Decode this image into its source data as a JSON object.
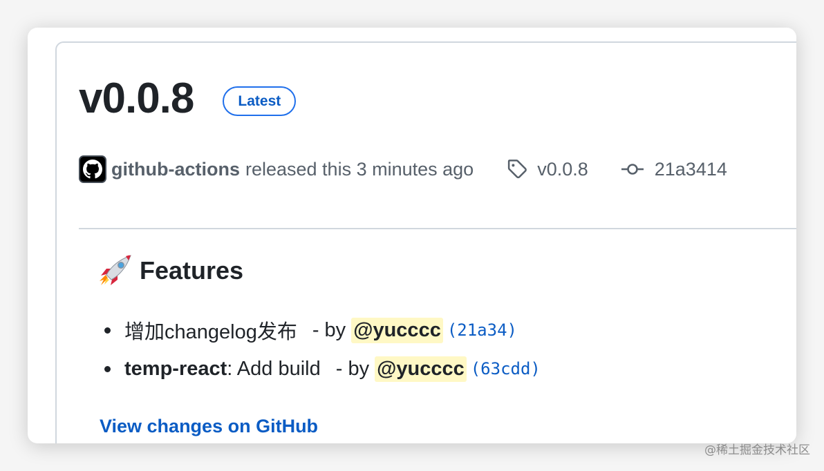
{
  "release": {
    "version": "v0.0.8",
    "badge": "Latest",
    "author": "github-actions",
    "released_text": "released this 3 minutes ago",
    "tag": "v0.0.8",
    "commit": "21a3414",
    "icons": {
      "avatar": "github-mark-icon",
      "tag": "tag-icon",
      "commit": "git-commit-icon"
    }
  },
  "notes": {
    "heading_emoji": "rocket-icon",
    "heading": "Features",
    "items": [
      {
        "scope": "",
        "text": "增加changelog发布",
        "by": "-  by",
        "mention": "@yucccc",
        "hash": "(21a34)"
      },
      {
        "scope": "temp-react",
        "text": ": Add build",
        "by": "-  by",
        "mention": "@yucccc",
        "hash": "(63cdd)"
      }
    ],
    "view_link": "View changes on GitHub"
  },
  "watermark": "@稀土掘金技术社区",
  "colors": {
    "link": "#0b5cc4",
    "badge_border": "#1f6feb",
    "mention_bg": "#fff8c5",
    "text": "#1f2328",
    "muted": "#57606a"
  }
}
